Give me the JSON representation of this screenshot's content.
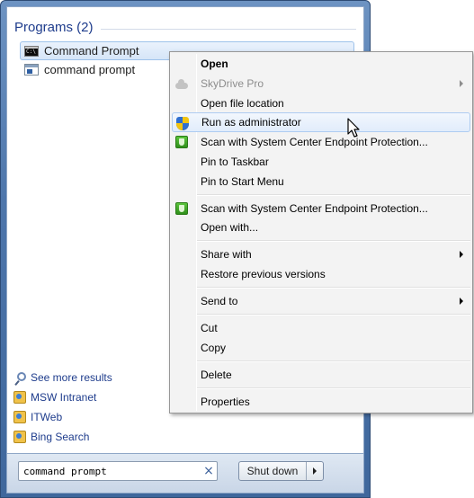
{
  "start_menu": {
    "programs_header": "Programs (2)",
    "programs": [
      {
        "label": "Command Prompt",
        "icon": "cmd-icon",
        "selected": true
      },
      {
        "label": "command prompt",
        "icon": "document-icon",
        "selected": false
      }
    ],
    "links": [
      {
        "label": "See more results",
        "icon": "search-icon"
      },
      {
        "label": "MSW Intranet",
        "icon": "favorite-icon"
      },
      {
        "label": "ITWeb",
        "icon": "favorite-icon"
      },
      {
        "label": "Bing Search",
        "icon": "favorite-icon"
      }
    ],
    "search": {
      "value": "command prompt",
      "clear_glyph": "×"
    },
    "shutdown": {
      "label": "Shut down"
    }
  },
  "context_menu": {
    "items": [
      {
        "label": "Open",
        "bold": true
      },
      {
        "label": "SkyDrive Pro",
        "disabled": true,
        "submenu": true,
        "icon": "cloud-icon"
      },
      {
        "label": "Open file location"
      },
      {
        "label": "Run as administrator",
        "icon": "uac-shield-icon",
        "hover": true
      },
      {
        "label": "Scan with System Center Endpoint Protection...",
        "icon": "endpoint-protection-icon"
      },
      {
        "label": "Pin to Taskbar"
      },
      {
        "label": "Pin to Start Menu"
      },
      {
        "label": "Scan with System Center Endpoint Protection...",
        "icon": "endpoint-protection-icon"
      },
      {
        "label": "Open with..."
      },
      {
        "label": "Share with",
        "submenu": true
      },
      {
        "label": "Restore previous versions"
      },
      {
        "label": "Send to",
        "submenu": true
      },
      {
        "label": "Cut"
      },
      {
        "label": "Copy"
      },
      {
        "label": "Delete"
      },
      {
        "label": "Properties"
      }
    ]
  },
  "colors": {
    "header_blue": "#1e3c8c",
    "frame_blue": "#4e76ab",
    "hover_border": "#aeccf1"
  }
}
